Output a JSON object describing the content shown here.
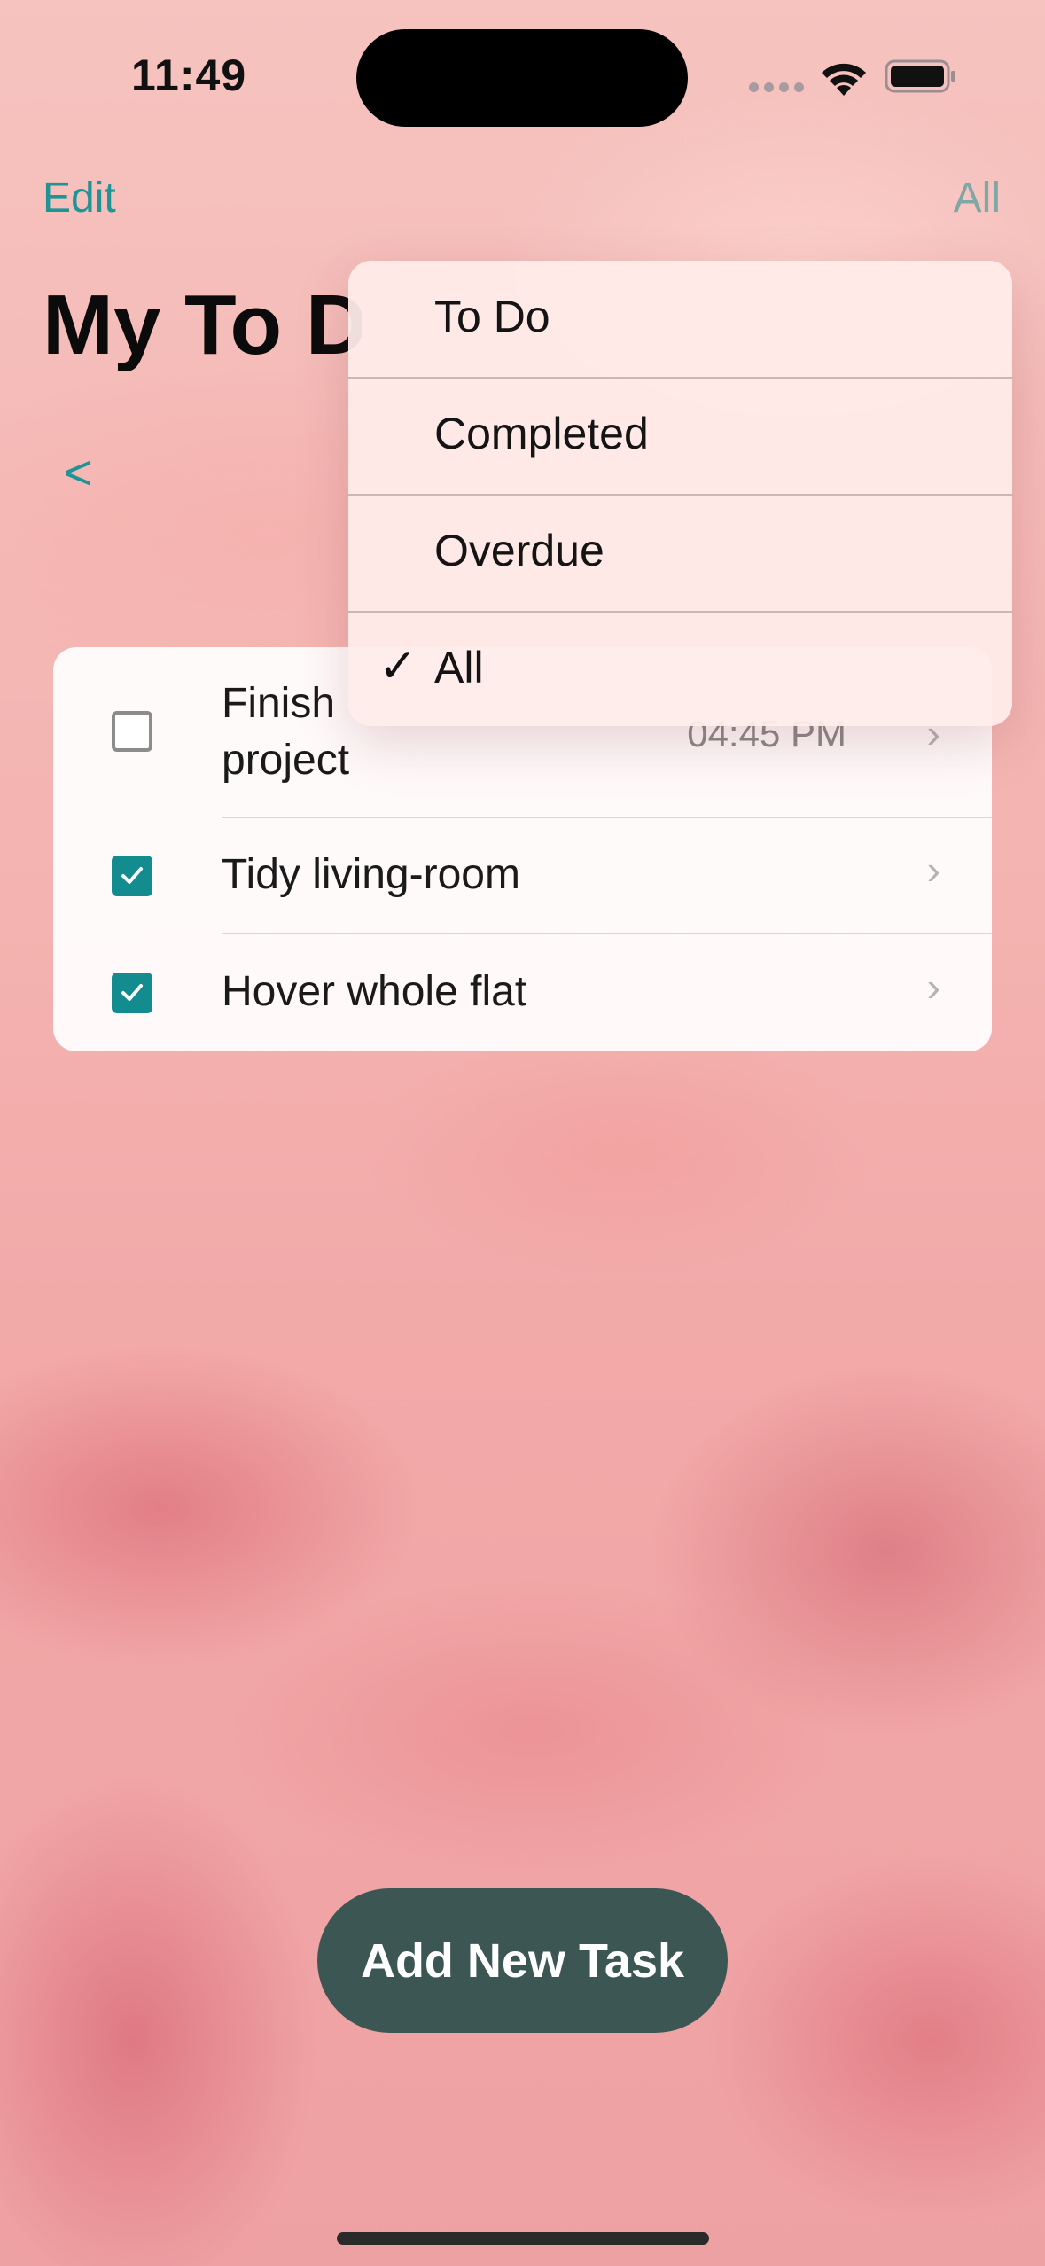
{
  "status_bar": {
    "time": "11:49"
  },
  "nav": {
    "edit_label": "Edit",
    "filter_label": "All"
  },
  "header": {
    "title": "My To Do",
    "back_label": "<"
  },
  "tasks": [
    {
      "title": "Finish ",
      "title_line2": "project",
      "time": "04:45 PM",
      "completed": false
    },
    {
      "title": "Tidy living-room",
      "completed": true
    },
    {
      "title": "Hover whole flat",
      "completed": true
    }
  ],
  "filter_menu": {
    "options": [
      {
        "label": "To Do",
        "selected": false
      },
      {
        "label": "Completed",
        "selected": false
      },
      {
        "label": "Overdue",
        "selected": false
      },
      {
        "label": "All",
        "selected": true
      }
    ],
    "check_glyph": "✓"
  },
  "footer": {
    "add_button_label": "Add New Task"
  },
  "colors": {
    "accent": "#1f9497",
    "checkbox_fill": "#138c8f",
    "button_bg": "#3c5654"
  },
  "icons": {
    "signal": "cellular-dots-icon",
    "wifi": "wifi-icon",
    "battery": "battery-icon",
    "chevron": "chevron-right-icon"
  }
}
